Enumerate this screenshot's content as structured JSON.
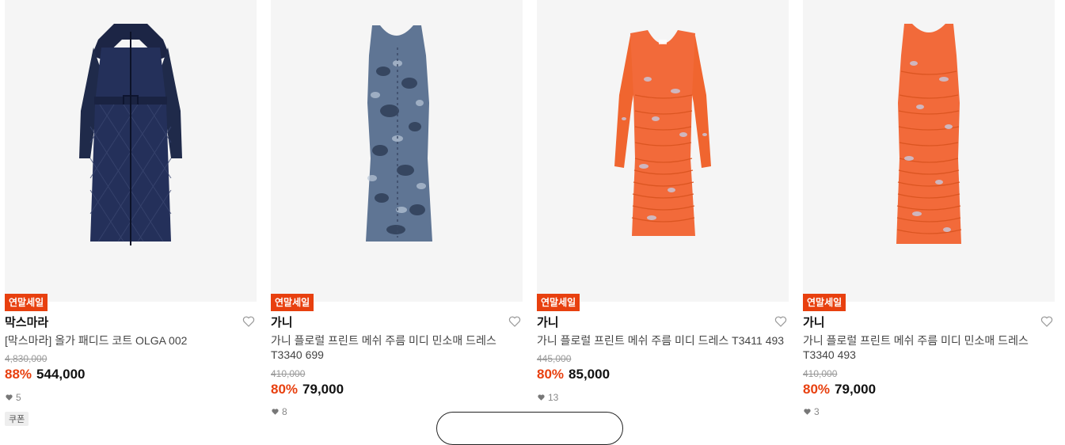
{
  "products": [
    {
      "badge": "연말세일",
      "brand": "막스마라",
      "name": "[막스마라] 올가 패디드 코트 OLGA 002",
      "original_price": "4,830,000",
      "discount": "88%",
      "price": "544,000",
      "likes": "5",
      "coupon": "쿠폰",
      "image": "navy-quilted-padded-coat"
    },
    {
      "badge": "연말세일",
      "brand": "가니",
      "name": "가니 플로럴 프린트 메쉬 주름 미디 민소매 드레스 T3340 699",
      "original_price": "410,000",
      "discount": "80%",
      "price": "79,000",
      "likes": "8",
      "image": "blue-floral-sleeveless-ruched-dress"
    },
    {
      "badge": "연말세일",
      "brand": "가니",
      "name": "가니 플로럴 프린트 메쉬 주름 미디 드레스 T3411 493",
      "original_price": "445,000",
      "discount": "80%",
      "price": "85,000",
      "likes": "13",
      "image": "orange-floral-long-sleeve-ruched-dress"
    },
    {
      "badge": "연말세일",
      "brand": "가니",
      "name": "가니 플로럴 프린트 메쉬 주름 미디 민소매 드레스 T3340 493",
      "original_price": "410,000",
      "discount": "80%",
      "price": "79,000",
      "likes": "3",
      "image": "orange-floral-sleeveless-ruched-dress"
    }
  ],
  "colors": {
    "accent": "#e8400f",
    "thumb_bg": "#f5f5f5",
    "navy": "#1f2a4a",
    "orange": "#f26a3a",
    "blue_print": "#6a7f9a"
  }
}
